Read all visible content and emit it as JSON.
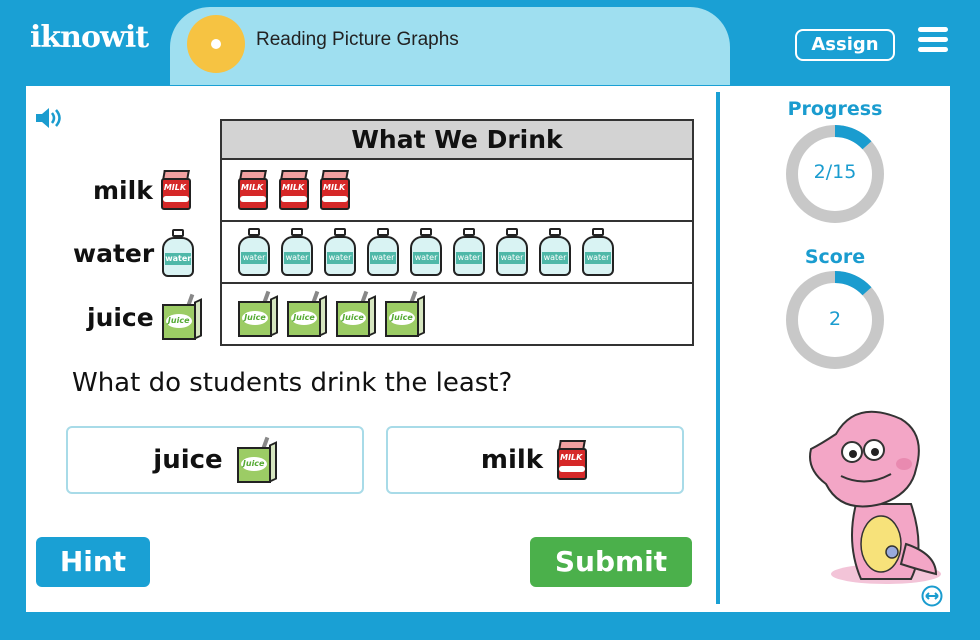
{
  "header": {
    "logo": "iknowit",
    "lesson_title": "Reading Picture Graphs",
    "assign_label": "Assign"
  },
  "graph": {
    "title": "What We Drink",
    "rows": [
      {
        "label": "milk",
        "icon": "milk-carton-icon",
        "count": 3
      },
      {
        "label": "water",
        "icon": "water-bottle-icon",
        "count": 9
      },
      {
        "label": "juice",
        "icon": "juice-box-icon",
        "count": 4
      }
    ],
    "icon_text": {
      "milk": "MILK",
      "water": "water",
      "juice": "Juice"
    }
  },
  "question": "What do students drink the least?",
  "choices": [
    {
      "label": "juice",
      "icon": "juice-box-icon"
    },
    {
      "label": "milk",
      "icon": "milk-carton-icon"
    }
  ],
  "buttons": {
    "hint": "Hint",
    "submit": "Submit"
  },
  "progress": {
    "label": "Progress",
    "text": "2/15",
    "current": 2,
    "total": 15
  },
  "score": {
    "label": "Score",
    "value": "2"
  },
  "colors": {
    "brand": "#1aa0d4",
    "title_bar": "#9fdff0",
    "title_dot": "#f6c342",
    "submit": "#4bb04b",
    "ring_track": "#c8c8c8",
    "ring_fill": "#1a9ccf"
  }
}
